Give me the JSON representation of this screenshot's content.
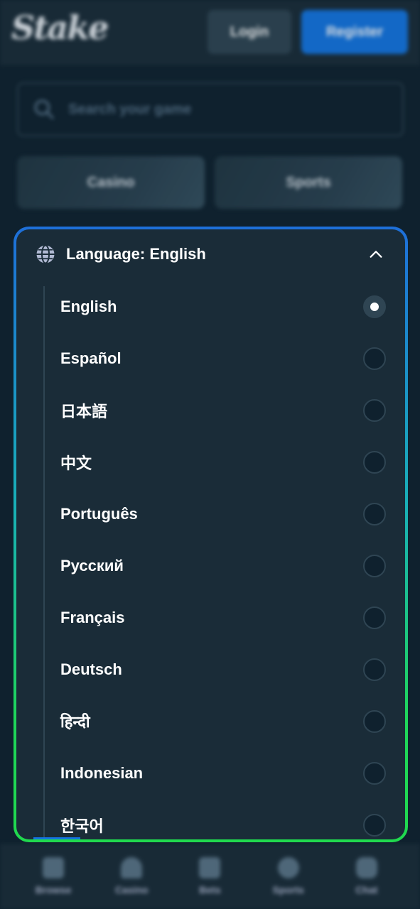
{
  "header": {
    "logo_text": "Stake",
    "login_label": "Login",
    "register_label": "Register"
  },
  "search": {
    "placeholder": "Search your game"
  },
  "tiles": {
    "casino_label": "Casino",
    "sports_label": "Sports"
  },
  "language_panel": {
    "title": "Language: English",
    "selected": "English",
    "options": [
      {
        "label": "English",
        "selected": true
      },
      {
        "label": "Español",
        "selected": false
      },
      {
        "label": "日本語",
        "selected": false
      },
      {
        "label": "中文",
        "selected": false
      },
      {
        "label": "Português",
        "selected": false
      },
      {
        "label": "Русский",
        "selected": false
      },
      {
        "label": "Français",
        "selected": false
      },
      {
        "label": "Deutsch",
        "selected": false
      },
      {
        "label": "हिन्दी",
        "selected": false
      },
      {
        "label": "Indonesian",
        "selected": false
      },
      {
        "label": "한국어",
        "selected": false
      }
    ]
  },
  "bottom_nav": [
    {
      "label": "Browse",
      "icon": "browse-icon"
    },
    {
      "label": "Casino",
      "icon": "casino-icon"
    },
    {
      "label": "Bets",
      "icon": "bets-icon"
    },
    {
      "label": "Sports",
      "icon": "sports-icon"
    },
    {
      "label": "Chat",
      "icon": "chat-icon"
    }
  ],
  "colors": {
    "background": "#0f212e",
    "panel": "#1a2c38",
    "accent_blue": "#1475e1",
    "border_gradient_top": "#1e6fd9",
    "border_gradient_bottom": "#20d94e"
  }
}
